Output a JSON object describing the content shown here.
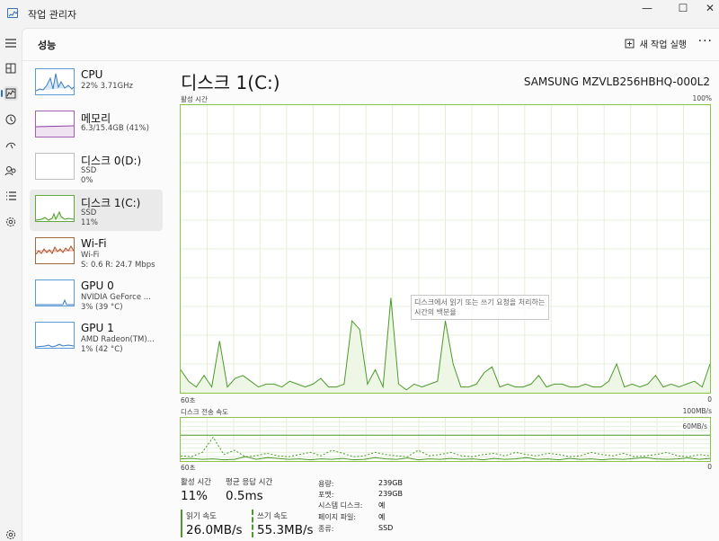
{
  "window": {
    "title": "작업 관리자",
    "minimize": "—",
    "maximize": "☐",
    "close": "✕"
  },
  "header": {
    "title": "성능",
    "new_task_label": "새 작업 실행",
    "more_label": "···"
  },
  "rail": {
    "icons": [
      "menu-icon",
      "processes-icon",
      "performance-icon",
      "app-history-icon",
      "startup-apps-icon",
      "users-icon",
      "details-icon",
      "services-icon",
      "settings-icon"
    ]
  },
  "devices": [
    {
      "name": "CPU",
      "line2": "22% 3.71GHz",
      "line3": ""
    },
    {
      "name": "메모리",
      "line2": "6.3/15.4GB (41%)",
      "line3": ""
    },
    {
      "name": "디스크 0(D:)",
      "line2": "SSD",
      "line3": "0%"
    },
    {
      "name": "디스크 1(C:)",
      "line2": "SSD",
      "line3": "11%"
    },
    {
      "name": "Wi-Fi",
      "line2": "Wi-Fi",
      "line3": "S: 0.6  R: 24.7 Mbps"
    },
    {
      "name": "GPU 0",
      "line2": "NVIDIA GeForce ...",
      "line3": "3% (39 °C)"
    },
    {
      "name": "GPU 1",
      "line2": "AMD Radeon(TM)...",
      "line3": "1% (42 °C)"
    }
  ],
  "main": {
    "title": "디스크 1(C:)",
    "model": "SAMSUNG MZVLB256HBHQ-000L2",
    "active_time_label": "활성 시간",
    "active_time_max": "100%",
    "x_left": "60초",
    "x_right": "0",
    "transfer_label": "디스크 전송 속도",
    "transfer_max": "100MB/s",
    "transfer_ref": "60MB/s",
    "x2_left": "60초",
    "x2_right": "0",
    "tooltip": "디스크에서 읽기 또는 쓰기 요청을 처리하는 시간의 백분율"
  },
  "stats": {
    "active_time_label": "활성 시간",
    "active_time_value": "11%",
    "response_label": "평균 응답 시간",
    "response_value": "0.5ms",
    "read_label": "읽기 속도",
    "read_value": "26.0MB/s",
    "write_label": "쓰기 속도",
    "write_value": "55.3MB/s"
  },
  "properties": [
    {
      "key": "용량:",
      "value": "239GB"
    },
    {
      "key": "포맷:",
      "value": "239GB"
    },
    {
      "key": "시스템 디스크:",
      "value": "예"
    },
    {
      "key": "페이지 파일:",
      "value": "예"
    },
    {
      "key": "종류:",
      "value": "SSD"
    }
  ],
  "colors": {
    "disk_green": "#4c9a2a",
    "disk_fill": "#eef6e6",
    "grid": "#e3efda",
    "selection": "#eaeaea",
    "accent": "#2f6fc5"
  },
  "chart_data": [
    {
      "type": "area",
      "ylabel": "활성 시간",
      "ylim": [
        0,
        100
      ],
      "xlim": [
        60,
        0
      ],
      "x_unit": "초",
      "series": [
        {
          "values": [
            8,
            4,
            2,
            6,
            2,
            18,
            2,
            5,
            6,
            4,
            2,
            3,
            3,
            2,
            4,
            3,
            2,
            3,
            5,
            2,
            2,
            3,
            25,
            22,
            3,
            8,
            2,
            33,
            3,
            1,
            3,
            2,
            3,
            4,
            25,
            10,
            2,
            2,
            3,
            7,
            9,
            2,
            3,
            2,
            2,
            3,
            6,
            2,
            3,
            3,
            2,
            2,
            3,
            2,
            2,
            4,
            10,
            2,
            3,
            2,
            3,
            6,
            2,
            3,
            2,
            3,
            4,
            2,
            10
          ]
        }
      ]
    },
    {
      "type": "line",
      "ylabel": "디스크 전송 속도",
      "ylim": [
        0,
        100
      ],
      "series": [
        {
          "values": [
            5,
            6,
            4,
            5,
            3,
            4,
            10,
            4,
            8,
            6,
            4,
            5,
            3,
            5,
            4,
            6,
            3,
            4,
            8,
            5,
            4,
            7,
            3,
            5,
            4,
            6,
            4,
            5,
            3,
            6,
            4,
            5,
            8,
            4,
            5,
            3,
            6,
            4,
            5,
            3,
            5,
            4,
            6,
            8,
            5,
            4,
            5,
            7,
            4,
            6
          ]
        },
        {
          "values": [
            12,
            10,
            20,
            55,
            15,
            25,
            10,
            12,
            18,
            12,
            10,
            15,
            20,
            12,
            25,
            18,
            10,
            12,
            20,
            15,
            12,
            10,
            25,
            12,
            15,
            20,
            12,
            10,
            15,
            18,
            12,
            20,
            15,
            12,
            18,
            15,
            10,
            12,
            20,
            15,
            12,
            18,
            10,
            12,
            15,
            20,
            12,
            10,
            15,
            12
          ]
        }
      ]
    }
  ]
}
